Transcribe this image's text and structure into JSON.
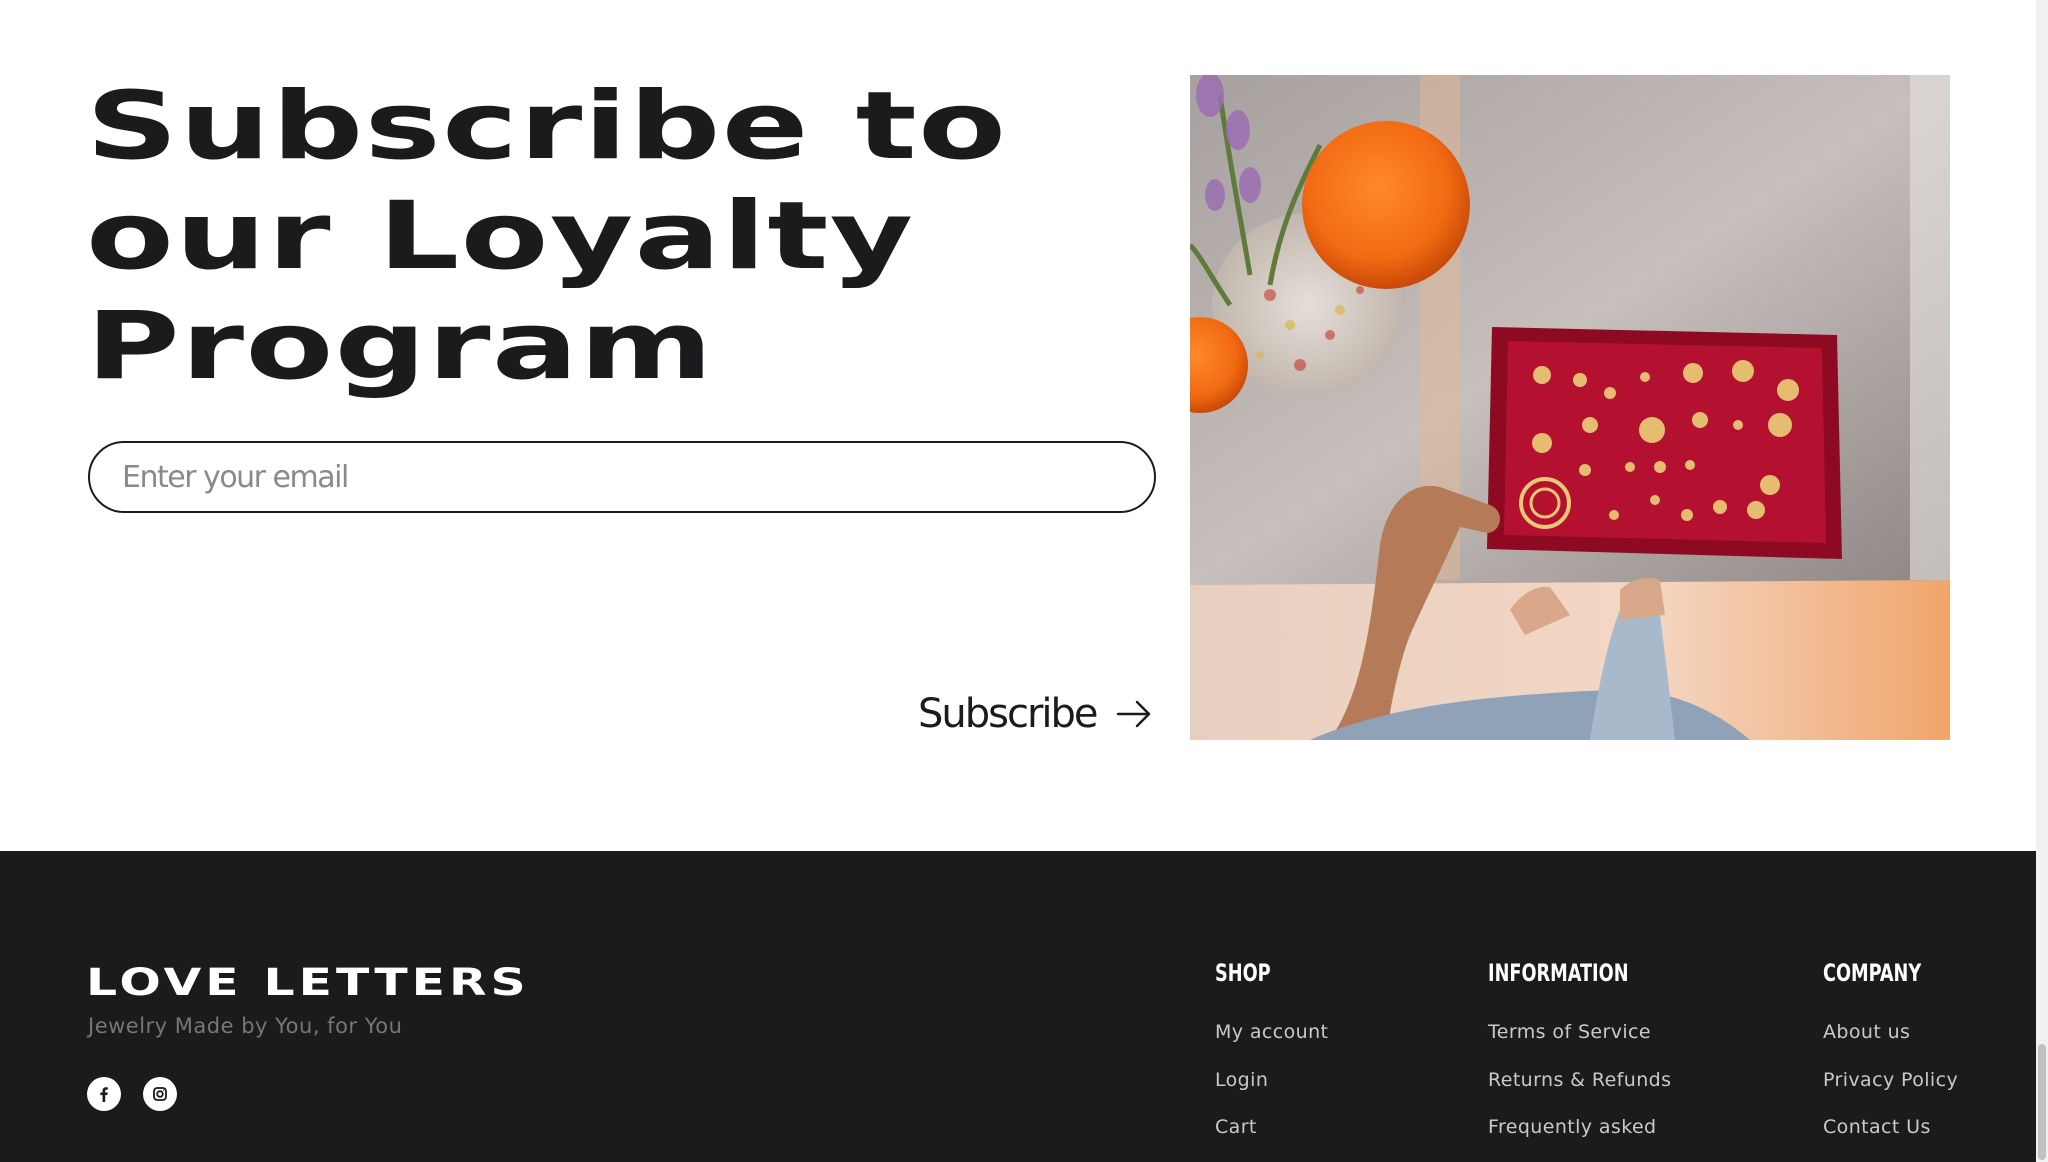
{
  "subscribe": {
    "headline_line1": "Subscribe to",
    "headline_line2": "our Loyalty",
    "headline_line3": "Program",
    "email_placeholder": "Enter your email",
    "button_label": "Subscribe",
    "button_icon": "arrow-right-icon"
  },
  "footer": {
    "brand": "LOVE LETTERS",
    "tagline": "Jewelry Made by You, for You",
    "social": [
      "facebook-icon",
      "instagram-icon"
    ],
    "columns": [
      {
        "title": "SHOP",
        "links": [
          "My account",
          "Login",
          "Cart"
        ]
      },
      {
        "title": "INFORMATION",
        "links": [
          "Terms of Service",
          "Returns & Refunds",
          "Frequently asked"
        ]
      },
      {
        "title": "COMPANY",
        "links": [
          "About us",
          "Privacy Policy",
          "Contact Us"
        ]
      }
    ]
  },
  "colors": {
    "text_dark": "#1b1b1d",
    "footer_bg": "#1b1b1d",
    "footer_link": "#c9c9cc",
    "tagline": "#76767a"
  }
}
